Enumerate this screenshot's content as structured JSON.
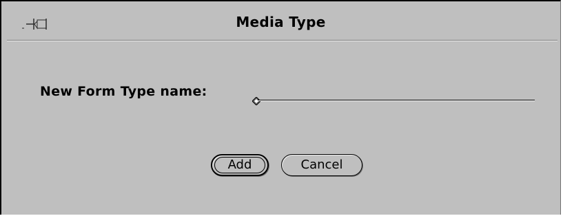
{
  "window": {
    "title": "Media Type"
  },
  "icons": {
    "pin": "pushpin-icon",
    "caret": "input-caret-icon"
  },
  "form": {
    "label": "New Form Type name:",
    "value": ""
  },
  "buttons": {
    "add_label": "Add",
    "cancel_label": "Cancel"
  },
  "colors": {
    "background": "#bfbfbf",
    "text": "#000000"
  }
}
